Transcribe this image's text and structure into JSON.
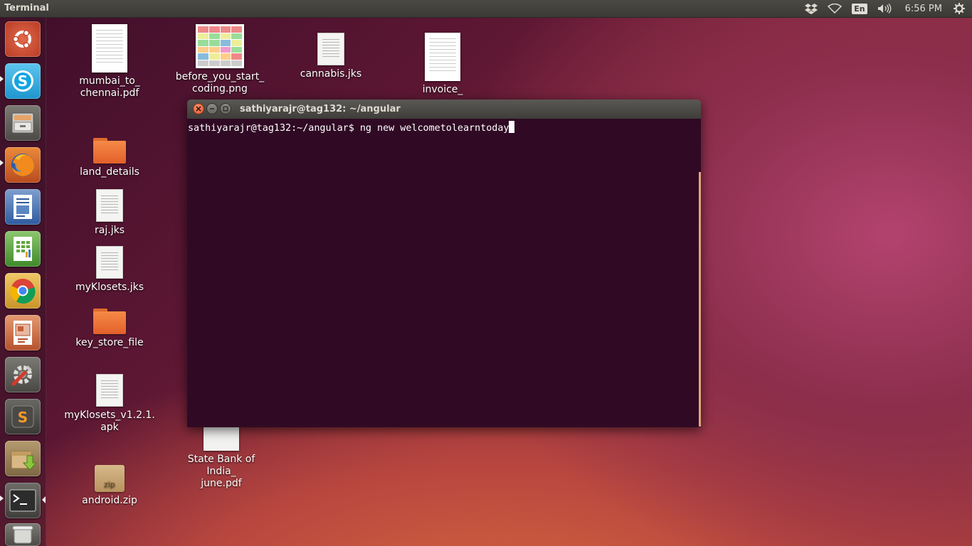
{
  "panel": {
    "title": "Terminal",
    "keyboard_layout": "En",
    "time": "6:56 PM",
    "icons": [
      "dropbox-icon",
      "wifi-icon",
      "keyboard-icon",
      "volume-icon",
      "settings-gear-icon"
    ]
  },
  "launcher": {
    "items": [
      {
        "name": "ubuntu-dash-icon"
      },
      {
        "name": "skype-icon"
      },
      {
        "name": "file-manager-icon"
      },
      {
        "name": "firefox-icon"
      },
      {
        "name": "libreoffice-writer-icon"
      },
      {
        "name": "libreoffice-calc-icon"
      },
      {
        "name": "chrome-icon"
      },
      {
        "name": "libreoffice-impress-icon"
      },
      {
        "name": "system-settings-icon"
      },
      {
        "name": "sublime-text-icon"
      },
      {
        "name": "software-updater-icon"
      },
      {
        "name": "terminal-icon"
      },
      {
        "name": "trash-icon"
      }
    ]
  },
  "desktop": {
    "files": [
      {
        "label": "mumbai_to_\nchennai.pdf",
        "type": "page"
      },
      {
        "label": "before_you_start_\ncoding.png",
        "type": "sheet"
      },
      {
        "label": "cannabis.jks",
        "type": "doc"
      },
      {
        "label": "invoice_",
        "type": "page"
      },
      {
        "label": "land_details",
        "type": "folder"
      },
      {
        "label": "raj.jks",
        "type": "doc"
      },
      {
        "label": "myKlosets.jks",
        "type": "doc"
      },
      {
        "label": "key_store_file",
        "type": "folder"
      },
      {
        "label": "myKlosets_v1.2.1.\napk",
        "type": "doc"
      },
      {
        "label": "State Bank of India_\njune.pdf",
        "type": "page"
      },
      {
        "label": "android.zip",
        "type": "zip",
        "badge": "zip"
      }
    ]
  },
  "terminal": {
    "window_title": "sathiyarajr@tag132: ~/angular",
    "prompt": "sathiyarajr@tag132:~/angular$",
    "command": " ng new welcometolearntoday",
    "colors": {
      "background": "#300a24",
      "text": "#ffffff"
    }
  },
  "colors": {
    "accent": "#e2542a",
    "panel": "#3b3a36"
  }
}
